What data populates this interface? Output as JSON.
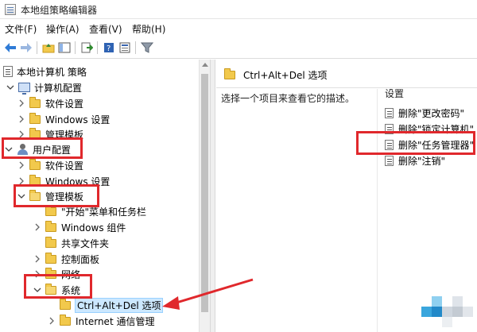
{
  "window": {
    "title": "本地组策略编辑器"
  },
  "menu": [
    {
      "label": "文件(F)"
    },
    {
      "label": "操作(A)"
    },
    {
      "label": "查看(V)"
    },
    {
      "label": "帮助(H)"
    }
  ],
  "toolbar_icons": [
    "back-arrow-icon",
    "forward-arrow-icon",
    "folder-up-icon",
    "show-hide-tree-icon",
    "export-list-icon",
    "help-icon",
    "properties-icon",
    "filter-icon"
  ],
  "tree": {
    "root": "本地计算机 策略",
    "computer_config": "计算机配置",
    "cc_software": "软件设置",
    "cc_windows": "Windows 设置",
    "cc_admin": "管理模板",
    "user_config": "用户配置",
    "uc_software": "软件设置",
    "uc_windows": "Windows 设置",
    "uc_admin": "管理模板",
    "start_menu": "\"开始\"菜单和任务栏",
    "win_components": "Windows 组件",
    "shared_folders": "共享文件夹",
    "control_panel": "控制面板",
    "network": "网络",
    "system": "系统",
    "ctrl_alt_del": "Ctrl+Alt+Del 选项",
    "internet_comm": "Internet 通信管理"
  },
  "right": {
    "header": "Ctrl+Alt+Del 选项",
    "description": "选择一个项目来查看它的描述。",
    "settings_header": "设置",
    "settings": [
      "删除\"更改密码\"",
      "删除\"锁定计算机\"",
      "删除\"任务管理器\"",
      "删除\"注销\""
    ]
  },
  "colors": {
    "annotation": "#e0282c",
    "folder": "#f2c94c"
  }
}
